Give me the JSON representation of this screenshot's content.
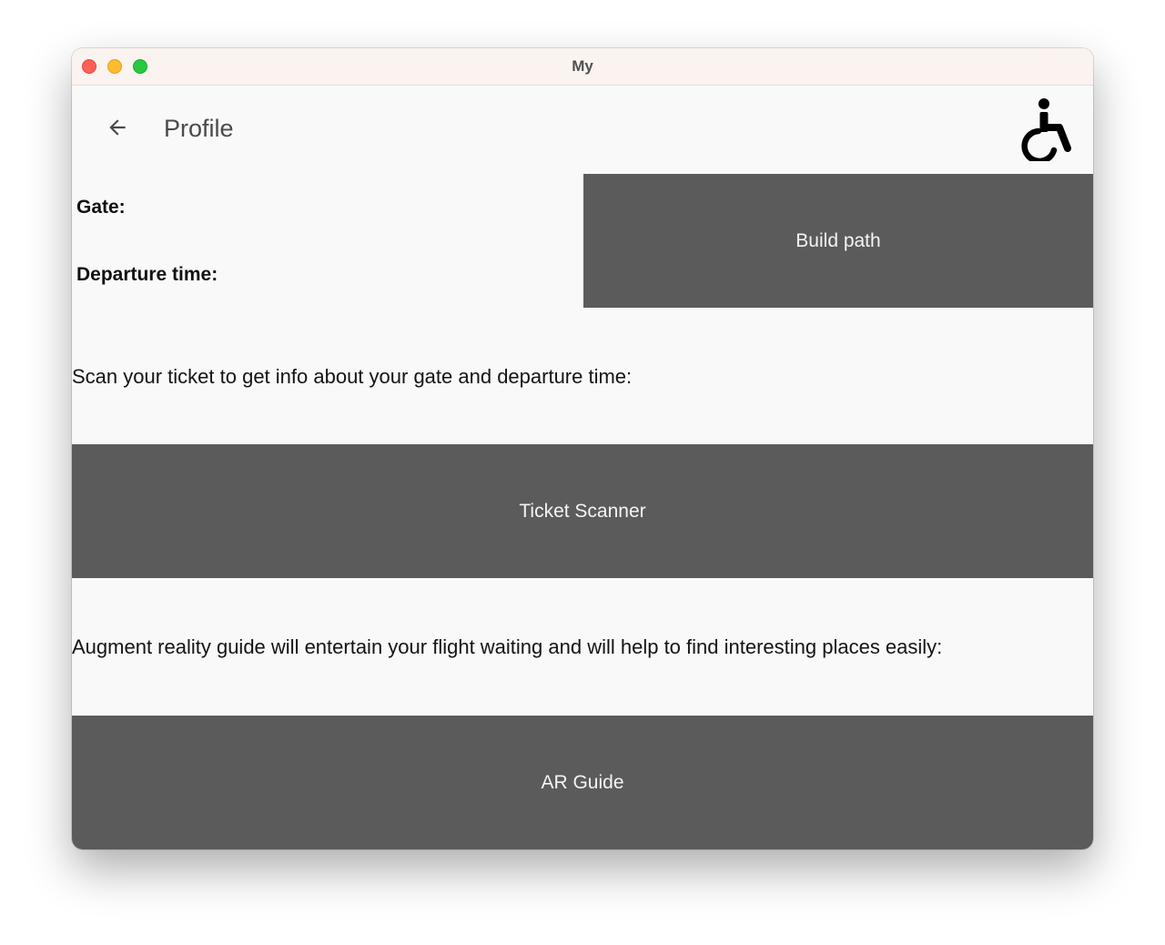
{
  "window": {
    "title": "My"
  },
  "appbar": {
    "back_icon": "arrow-left-icon",
    "title": "Profile",
    "accessibility_icon": "wheelchair-icon"
  },
  "info": {
    "gate_label": "Gate:",
    "departure_label": "Departure time:"
  },
  "buttons": {
    "build_path": "Build path",
    "ticket_scanner": "Ticket Scanner",
    "ar_guide": "AR Guide"
  },
  "text": {
    "scan_instruction": "Scan your ticket to get info about your gate and departure time:",
    "ar_description": "Augment reality guide will entertain your flight waiting and will help to find interesting places easily:"
  },
  "colors": {
    "button_bg": "#5b5b5b",
    "button_text": "#f4f4f4",
    "page_bg": "#f9f9f9",
    "titlebar_bg": "#fbf3ef"
  }
}
